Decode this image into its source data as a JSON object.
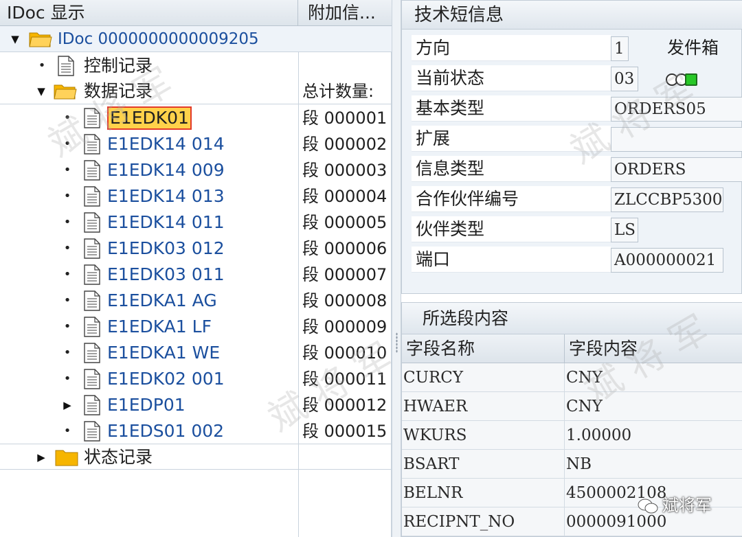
{
  "tree": {
    "header": {
      "col1": "IDoc 显示",
      "col2": "附加信..."
    },
    "root": {
      "label": "IDoc 0000000000009205"
    },
    "control_record": {
      "label": "控制记录"
    },
    "data_record": {
      "label": "数据记录",
      "total_label": "总计数量:"
    },
    "segments": [
      {
        "name": "E1EDK01",
        "segment": "段 000001",
        "selected": true
      },
      {
        "name": "E1EDK14 014",
        "segment": "段 000002"
      },
      {
        "name": "E1EDK14 009",
        "segment": "段 000003"
      },
      {
        "name": "E1EDK14 013",
        "segment": "段 000004"
      },
      {
        "name": "E1EDK14 011",
        "segment": "段 000005"
      },
      {
        "name": "E1EDK03 012",
        "segment": "段 000006"
      },
      {
        "name": "E1EDK03 011",
        "segment": "段 000007"
      },
      {
        "name": "E1EDKA1 AG",
        "segment": "段 000008"
      },
      {
        "name": "E1EDKA1 LF",
        "segment": "段 000009"
      },
      {
        "name": "E1EDKA1 WE",
        "segment": "段 000010"
      },
      {
        "name": "E1EDK02 001",
        "segment": "段 000011"
      },
      {
        "name": "E1EDP01",
        "segment": "段 000012",
        "expandable": true
      },
      {
        "name": "E1EDS01 002",
        "segment": "段 000015"
      }
    ],
    "status_record": {
      "label": "状态记录"
    }
  },
  "tech_info": {
    "title": "技术短信息",
    "fields": [
      {
        "label": "方向",
        "value": "1",
        "extra": "发件箱"
      },
      {
        "label": "当前状态",
        "value": "03"
      },
      {
        "label": "基本类型",
        "value": "ORDERS05"
      },
      {
        "label": "扩展",
        "value": ""
      },
      {
        "label": "信息类型",
        "value": "ORDERS"
      },
      {
        "label": "合作伙伴编号",
        "value": "ZLCCBP5300"
      },
      {
        "label": "伙伴类型",
        "value": "LS"
      },
      {
        "label": "端口",
        "value": "A000000021"
      }
    ],
    "status_lights": {
      "red": "off",
      "yellow": "off",
      "green": "on"
    }
  },
  "segment_content": {
    "title": "所选段内容",
    "col_field_name": "字段名称",
    "col_field_value": "字段内容",
    "rows": [
      {
        "field": "CURCY",
        "value": "CNY"
      },
      {
        "field": "HWAER",
        "value": "CNY"
      },
      {
        "field": "WKURS",
        "value": "1.00000"
      },
      {
        "field": "BSART",
        "value": "NB"
      },
      {
        "field": "BELNR",
        "value": "4500002108"
      },
      {
        "field": "RECIPNT_NO",
        "value": "0000091000"
      }
    ]
  },
  "watermark": {
    "text": "斌将军"
  },
  "colors": {
    "link_blue": "#1b4f9e",
    "selection_fill": "#ffd24a",
    "selection_border": "#e23a2a",
    "folder_yellow": "#f6b500",
    "status_green": "#28c828"
  }
}
